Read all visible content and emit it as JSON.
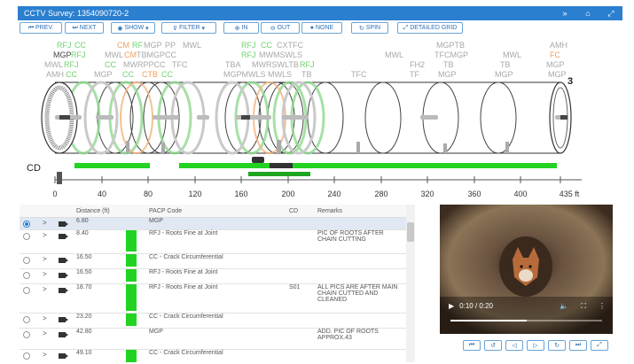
{
  "window": {
    "title": "CCTV Survey: 1354090720-2",
    "controls": [
      "»",
      "⌂",
      "⤢"
    ]
  },
  "toolbar": {
    "prev": "PREV.",
    "next": "NEXT",
    "show": "SHOW",
    "filter": "FILTER",
    "in": "IN",
    "out": "OUT",
    "none": "NONE",
    "spin": "SPIN",
    "detailed_grid": "DETAILED GRID"
  },
  "diagram": {
    "pipe_number": "3",
    "cd_label": "CD",
    "axis_ticks": [
      "0",
      "40",
      "80",
      "120",
      "160",
      "200",
      "240",
      "280",
      "320",
      "360",
      "400",
      "435 ft"
    ],
    "labels_row1": [
      {
        "t": "RFJ",
        "c": "g"
      },
      {
        "t": "CC",
        "c": "g"
      },
      {
        "t": "CM",
        "c": "o"
      },
      {
        "t": "RF",
        "c": "g"
      },
      {
        "t": "MGP",
        "c": ""
      },
      {
        "t": "PP",
        "c": ""
      },
      {
        "t": "MWL",
        "c": ""
      },
      {
        "t": "RFJ",
        "c": "g"
      },
      {
        "t": "CC",
        "c": "g"
      },
      {
        "t": "CXTFC",
        "c": ""
      },
      {
        "t": "MGPTB",
        "c": ""
      },
      {
        "t": "AMH",
        "c": ""
      }
    ],
    "labels_row2": [
      "MGP",
      "RFJ",
      "MWL",
      "CM",
      "TBMGPCC",
      "RFJ",
      "MWMSWLS",
      "TFCMGP",
      "MWL",
      "MWL",
      "FC"
    ],
    "labels_row3": [
      "MWL",
      "RFJ",
      "CC",
      "MWRPPCC",
      "TFC",
      "TBA",
      "MWRSWLTB",
      "RFJ",
      "FH2",
      "TB",
      "TB",
      "MGP"
    ],
    "labels_row4": [
      "AMH",
      "CC",
      "MGP",
      "CC",
      "CTB",
      "CC",
      "MGPMWLS",
      "MWLS",
      "TB",
      "TFC",
      "TF",
      "MGP",
      "MGP",
      "MGP"
    ]
  },
  "table": {
    "headers": [
      "Distance (ft)",
      "PACP Code",
      "CD",
      "Remarks"
    ],
    "rows": [
      {
        "distance": "6.80",
        "code": "MGP",
        "cd": "",
        "remarks": "",
        "swatch": false,
        "selected": true
      },
      {
        "distance": "8.40",
        "code": "RFJ - Roots Fine at Joint",
        "cd": "",
        "remarks": "PIC OF ROOTS AFTER CHAIN CUTTING",
        "swatch": true
      },
      {
        "distance": "16.50",
        "code": "CC - Crack Circumferential",
        "cd": "",
        "remarks": "",
        "swatch": true
      },
      {
        "distance": "16.50",
        "code": "RFJ - Roots Fine at Joint",
        "cd": "",
        "remarks": "",
        "swatch": true
      },
      {
        "distance": "18.70",
        "code": "RFJ - Roots Fine at Joint",
        "cd": "S01",
        "remarks": "ALL PICS ARE AFTER MAIN CHAIN CUTTED AND CLEANED",
        "swatch": true
      },
      {
        "distance": "23.20",
        "code": "CC - Crack Circumferential",
        "cd": "",
        "remarks": "",
        "swatch": true
      },
      {
        "distance": "42.80",
        "code": "MGP",
        "cd": "",
        "remarks": "ADD. PIC OF ROOTS APPROX.43",
        "swatch": false
      },
      {
        "distance": "49.10",
        "code": "CC - Crack Circumferential",
        "cd": "",
        "remarks": "",
        "swatch": true
      }
    ]
  },
  "video": {
    "time": "0:10 / 0:20",
    "progress": 0.5
  },
  "colors": {
    "accent": "#2a7fcf",
    "defect_green": "#22d322"
  }
}
